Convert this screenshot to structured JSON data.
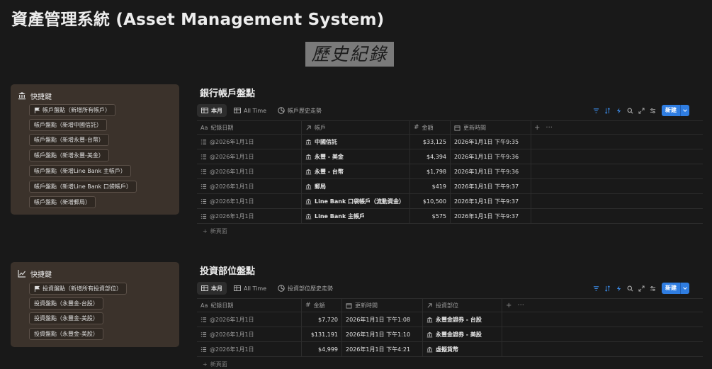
{
  "page": {
    "title": "資產管理系統 (Asset Management System)",
    "banner": "歷史紀錄"
  },
  "quick1": {
    "header": "快捷鍵",
    "buttons": [
      "帳戶盤點（新增所有帳戶）",
      "帳戶盤點（新增中國信託）",
      "帳戶盤點（新增永豐-台幣）",
      "帳戶盤點（新增永豐-美金）",
      "帳戶盤點（新增Line Bank 主帳戶）",
      "帳戶盤點（新增Line Bank 口袋帳戶）",
      "帳戶盤點（新增郵局）"
    ]
  },
  "quick2": {
    "header": "快捷鍵",
    "buttons": [
      "投資盤點（新增所有投資部位）",
      "投資盤點（永豐金-台股）",
      "投資盤點（永豐金-美股）",
      "投資盤點（永豐金-美股）"
    ]
  },
  "db1": {
    "title": "銀行帳戶盤點",
    "tabs": [
      "本月",
      "All Time",
      "帳戶歷史走勢"
    ],
    "new_label": "新建",
    "columns": [
      "紀錄日期",
      "帳戶",
      "金額",
      "更新時間"
    ],
    "rows": [
      {
        "date": "@2026年1月1日",
        "account": "中國信託",
        "amount": "$33,125",
        "updated": "2026年1月1日 下午9:35"
      },
      {
        "date": "@2026年1月1日",
        "account": "永豐 - 美金",
        "amount": "$4,394",
        "updated": "2026年1月1日 下午9:36"
      },
      {
        "date": "@2026年1月1日",
        "account": "永豐 - 台幣",
        "amount": "$1,798",
        "updated": "2026年1月1日 下午9:36"
      },
      {
        "date": "@2026年1月1日",
        "account": "郵局",
        "amount": "$419",
        "updated": "2026年1月1日 下午9:37"
      },
      {
        "date": "@2026年1月1日",
        "account": "Line Bank 口袋帳戶（流動資金）",
        "amount": "$10,500",
        "updated": "2026年1月1日 下午9:37"
      },
      {
        "date": "@2026年1月1日",
        "account": "Line Bank 主帳戶",
        "amount": "$575",
        "updated": "2026年1月1日 下午9:37"
      }
    ],
    "add_label": "新頁面"
  },
  "db2": {
    "title": "投資部位盤點",
    "tabs": [
      "本月",
      "All Time",
      "投資部位歷史走勢"
    ],
    "new_label": "新建",
    "columns": [
      "紀錄日期",
      "金額",
      "更新時間",
      "投資部位"
    ],
    "rows": [
      {
        "date": "@2026年1月1日",
        "amount": "$7,720",
        "updated": "2026年1月1日 下午1:08",
        "position": "永豐金證券 - 台股"
      },
      {
        "date": "@2026年1月1日",
        "amount": "$131,191",
        "updated": "2026年1月1日 下午1:10",
        "position": "永豐金證券 - 美股"
      },
      {
        "date": "@2026年1月1日",
        "amount": "$4,999",
        "updated": "2026年1月1日 下午4:21",
        "position": "虛擬貨幣"
      }
    ],
    "add_label": "新頁面"
  },
  "colors": {
    "accent": "#2f7de1",
    "quick_box": "#3b322b",
    "background": "#191919"
  }
}
